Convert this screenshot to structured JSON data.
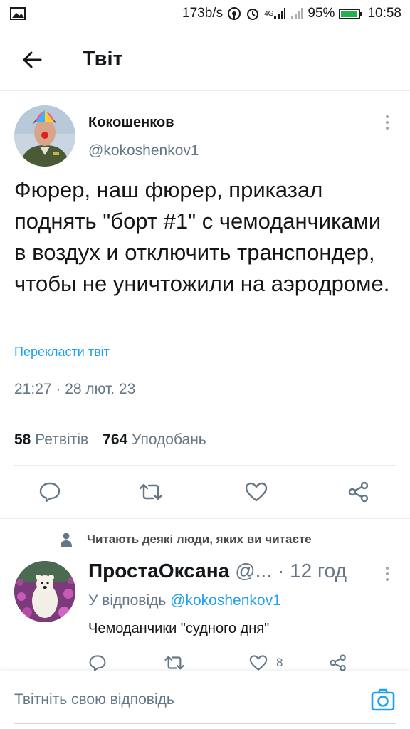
{
  "status_bar": {
    "network_speed": "173b/s",
    "network_type": "4G",
    "battery": "95%",
    "battery_level": 0.95,
    "time": "10:58",
    "icons": [
      "image-icon",
      "hotspot-icon",
      "alarm-icon",
      "signal-icon",
      "signal-icon-2",
      "battery-icon"
    ]
  },
  "header": {
    "title": "Твіт",
    "back_icon": "arrow-left-icon"
  },
  "tweet": {
    "author_name": "Кокошенков",
    "author_handle": "@kokoshenkov1",
    "text": "Фюрер, наш фюрер, приказал поднять \"борт #1\" с чемоданчиками в воздух и отключить транспондер, чтобы не уничтожили на аэродроме.",
    "translate_label": "Перекласти твіт",
    "timestamp": "21:27 · 28 лют. 23",
    "retweets_count": "58",
    "retweets_label": "Ретвітів",
    "likes_count": "764",
    "likes_label": "Уподобань",
    "action_icons": [
      "reply-icon",
      "retweet-icon",
      "like-icon",
      "share-icon"
    ]
  },
  "social_context": {
    "text": "Читають деякі люди, яких ви читаєте",
    "icon": "person-icon"
  },
  "reply": {
    "name": "ПростаОксана",
    "handle": "@...",
    "time": "· 12 год",
    "reply_to_label": "У відповідь",
    "reply_to_mention": "@kokoshenkov1",
    "text": "Чемоданчики \"судного дня\"",
    "likes_count": "8"
  },
  "compose": {
    "placeholder": "Твітніть свою відповідь",
    "camera_icon": "camera-icon"
  },
  "colors": {
    "accent": "#1da1f2",
    "secondary_text": "#657786",
    "divider": "#e6ecf0",
    "battery": "#22b14c"
  }
}
